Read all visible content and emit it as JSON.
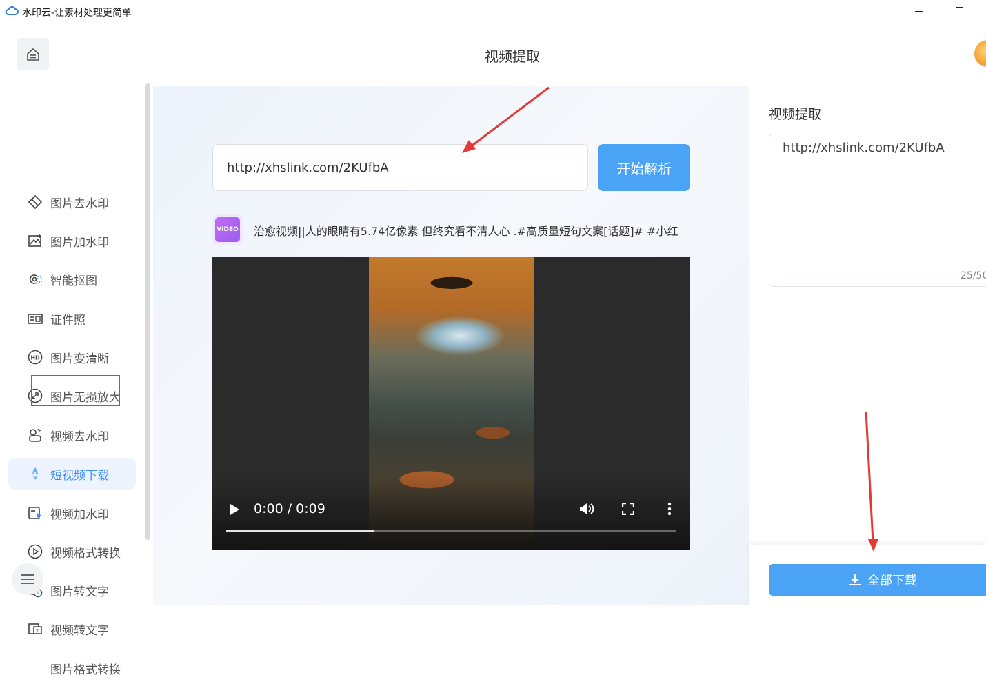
{
  "window": {
    "title": "水印云-让素材处理更简单",
    "minimize_icon": "minimize-icon",
    "maximize_icon": "maximize-icon"
  },
  "header": {
    "title": "视频提取",
    "home_icon": "home-icon",
    "avatar": "user-avatar"
  },
  "sidebar": {
    "items": [
      {
        "label": "图片去水印",
        "icon": "eraser-icon"
      },
      {
        "label": "图片加水印",
        "icon": "image-add-icon"
      },
      {
        "label": "智能抠图",
        "icon": "cutout-icon"
      },
      {
        "label": "证件照",
        "icon": "id-photo-icon"
      },
      {
        "label": "图片变清晰",
        "icon": "hd-icon"
      },
      {
        "label": "图片无损放大",
        "icon": "enlarge-icon"
      },
      {
        "label": "视频去水印",
        "icon": "video-eraser-icon"
      },
      {
        "label": "短视频下载",
        "icon": "download-icon",
        "active": true
      },
      {
        "label": "视频加水印",
        "icon": "video-add-icon"
      },
      {
        "label": "视频格式转换",
        "icon": "convert-icon"
      },
      {
        "label": "图片转文字",
        "icon": "image-text-icon"
      },
      {
        "label": "视频转文字",
        "icon": "video-text-icon"
      },
      {
        "label": "图片格式转换",
        "icon": "image-convert-icon"
      }
    ],
    "menu_icon": "menu-icon"
  },
  "main": {
    "url_value": "http://xhslink.com/2KUfbA",
    "parse_button": "开始解析",
    "badge_text": "VIDEO",
    "caption": "治愈视频||人的眼睛有5.74亿像素 但终究看不清人心 .#高质量短句文案[话题]# #小红",
    "player": {
      "time": "0:00 / 0:09",
      "progress": 0.33,
      "play_icon": "play-icon",
      "volume_icon": "volume-icon",
      "fullscreen_icon": "fullscreen-icon",
      "more_icon": "more-vertical-icon"
    }
  },
  "panel": {
    "title": "视频提取",
    "text": "http://xhslink.com/2KUfbA",
    "char_count": "25/50",
    "download_button": "全部下载",
    "download_icon": "download-arrow-icon"
  },
  "colors": {
    "accent": "#4aa3f5",
    "active_text": "#3d8ff5",
    "annotation": "#e53935"
  }
}
